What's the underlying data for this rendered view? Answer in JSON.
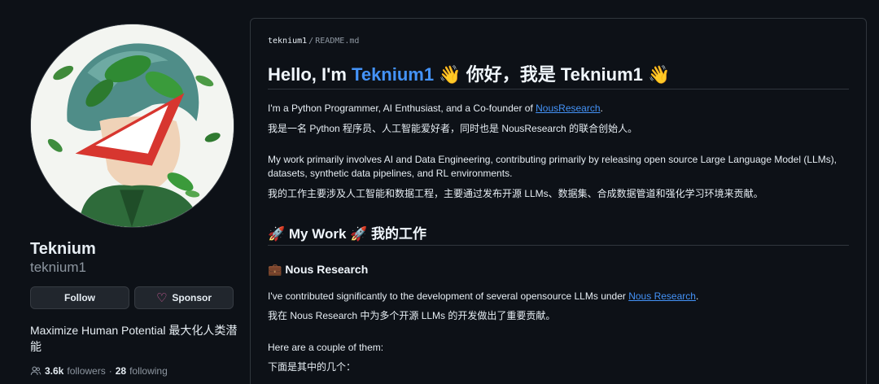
{
  "profile": {
    "display_name": "Teknium",
    "login": "teknium1",
    "follow_label": "Follow",
    "sponsor_label": "Sponsor",
    "bio": "Maximize Human Potential  最大化人类潜能",
    "followers_count": "3.6k",
    "followers_label": "followers",
    "separator": "·",
    "following_count": "28",
    "following_label": "following",
    "icons": {
      "heart": "heart-icon",
      "people": "people-icon"
    }
  },
  "readme": {
    "owner": "teknium1",
    "path_sep": "/",
    "file": "README.md",
    "h1_prefix": "Hello, I'm ",
    "h1_name": "Teknium1",
    "h1_suffix": " 👋 你好，我是 Teknium1 👋",
    "p1_text": "I'm a Python Programmer, AI Enthusiast, and a Co-founder of ",
    "p1_link": "NousResearch",
    "p1_end": ".",
    "p1_cn": "我是一名 Python 程序员、人工智能爱好者，同时也是 NousResearch 的联合创始人。",
    "p2_en": "My work primarily involves AI and Data Engineering, contributing primarily by releasing open source Large Language Model (LLMs), datasets, synthetic data pipelines, and RL environments.",
    "p2_cn": "我的工作主要涉及人工智能和数据工程，主要通过发布开源 LLMs、数据集、合成数据管道和强化学习环境来贡献。",
    "h2": "🚀 My Work 🚀 我的工作",
    "h3": "💼 Nous Research",
    "p3_text": "I've contributed significantly to the development of several opensource LLMs under ",
    "p3_link": "Nous Research",
    "p3_end": ".",
    "p3_cn": "我在 Nous Research 中为多个开源 LLMs 的开发做出了重要贡献。",
    "p4_en": "Here are a couple of them:",
    "p4_cn": "下面是其中的几个："
  },
  "colors": {
    "background": "#0d1117",
    "text": "#e6edf3",
    "muted": "#8d96a0",
    "link": "#4493f8",
    "border": "#30363d",
    "sponsor_heart": "#db61a2"
  }
}
